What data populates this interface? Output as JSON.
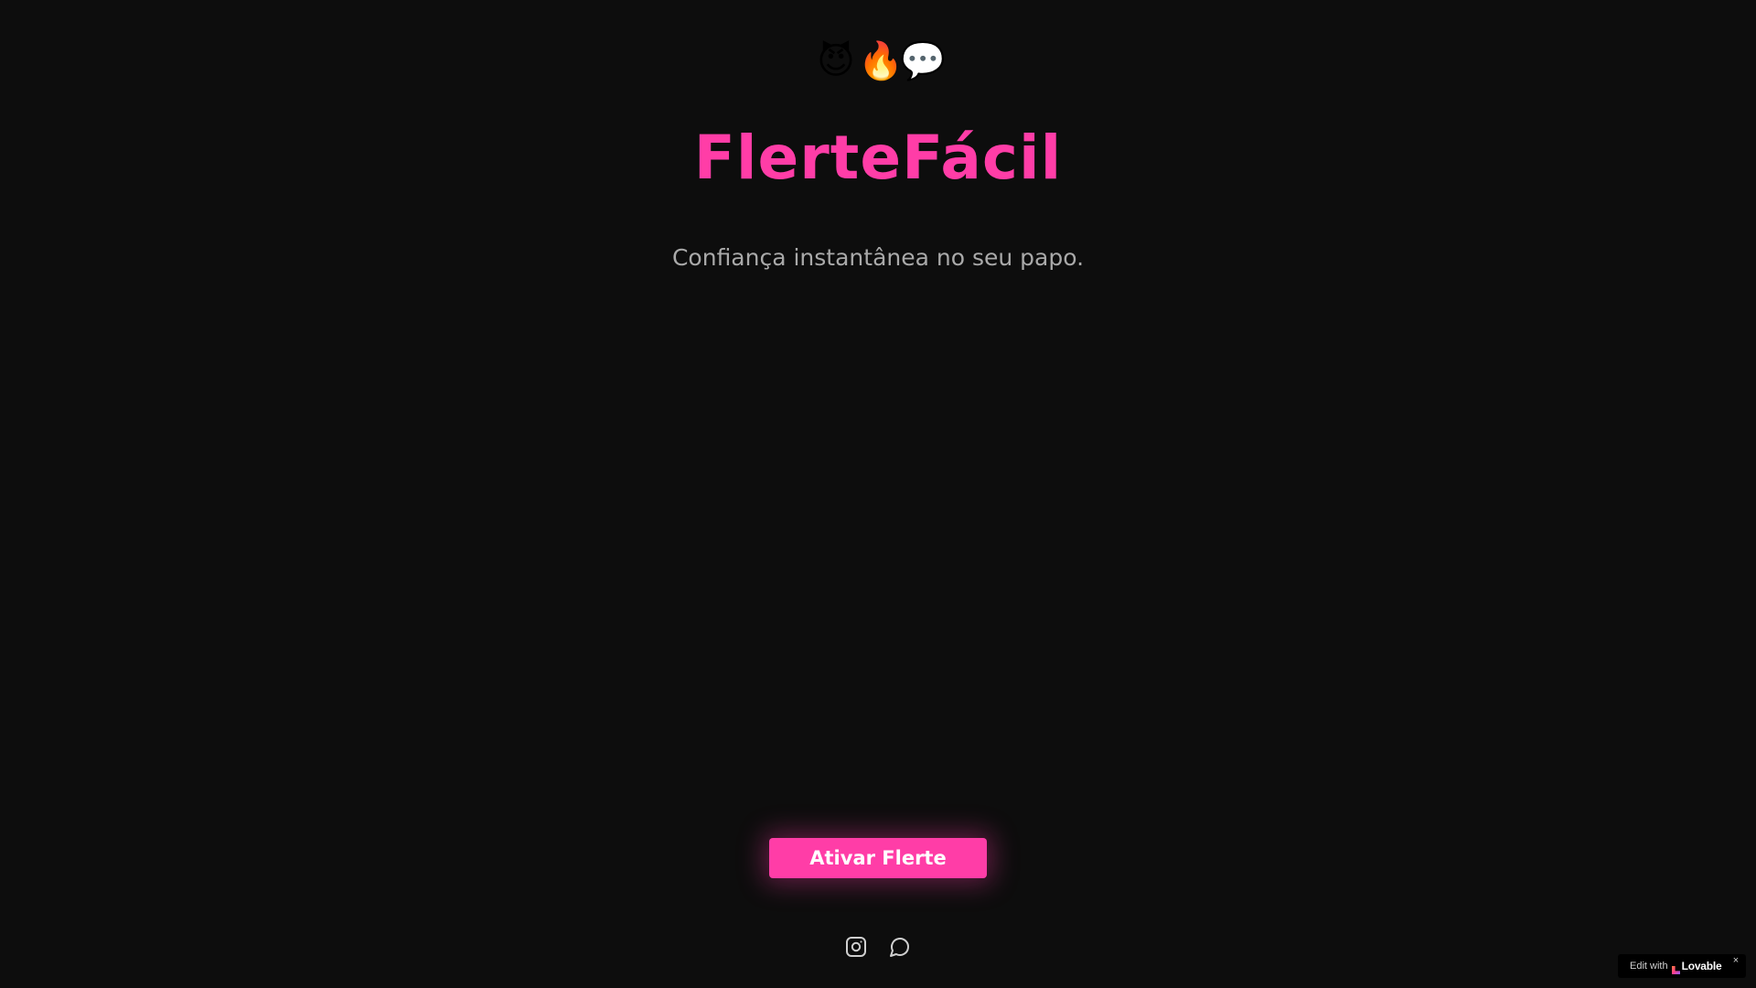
{
  "app": {
    "emojis": [
      "😈",
      "🔥",
      "💬"
    ],
    "title": "FlerteFácil",
    "subtitle": "Confiança instantânea no seu papo.",
    "cta_label": "Ativar Flerte",
    "accent_color": "#ff3da7",
    "background_color": "#0d0d0d"
  },
  "socials": [
    {
      "icon": "instagram-icon"
    },
    {
      "icon": "chat-bubble-icon"
    }
  ],
  "badge": {
    "prefix": "Edit with",
    "brand": "Lovable",
    "close": "×"
  }
}
